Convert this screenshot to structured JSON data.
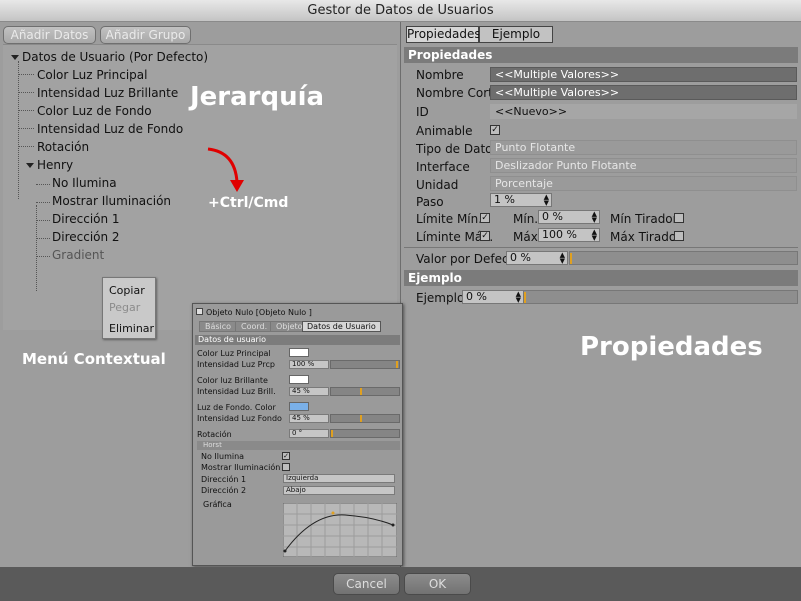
{
  "window": {
    "title": "Gestor de Datos de Usuarios"
  },
  "toolbar": {
    "add_data": "Añadir Datos",
    "add_group": "Añadir Grupo"
  },
  "tree": {
    "root": "Datos de Usuario (Por Defecto)",
    "items": [
      "Color Luz Principal",
      "Intensidad Luz Brillante",
      "Color Luz de Fondo",
      "Intensidad  Luz de Fondo",
      "Rotación"
    ],
    "group": "Henry",
    "group_items": [
      "No Ilumina",
      "Mostrar Iluminación",
      "Dirección 1",
      "Dirección 2",
      "Gradient"
    ]
  },
  "annotations": {
    "hierarchy": "Jerarquía",
    "ctrl": "+Ctrl/Cmd",
    "context_menu": "Menú Contextual",
    "properties": "Propiedades"
  },
  "context_menu": {
    "copy": "Copiar",
    "paste": "Pegar",
    "delete": "Eliminar"
  },
  "tabs": [
    "Propiedades",
    "Ejemplo"
  ],
  "props": {
    "section": "Propiedades",
    "name_label": "Nombre",
    "name_value": "<<Multiple Valores>>",
    "short_label": "Nombre Corto",
    "short_value": "<<Multiple Valores>>",
    "id_label": "ID",
    "id_value": "<<Nuevo>>",
    "animable_label": "Animable",
    "type_label": "Tipo de Dato",
    "type_value": "Punto Flotante",
    "iface_label": "Interface",
    "iface_value": "Deslizador Punto Flotante",
    "unit_label": "Unidad",
    "unit_value": "Porcentaje",
    "step_label": "Paso",
    "step_value": "1 %",
    "minlim_label": "Límite Mín.",
    "min_label": "Mín.",
    "min_value": "0 %",
    "mintir_label": "Mín Tirador",
    "maxlim_label": "Líminte Máx.",
    "max_label": "Máx",
    "max_value": "100 %",
    "maxtir_label": "Máx Tirador",
    "default_label": "Valor por Defecto",
    "default_value": "0 %",
    "default_fill": 0.0
  },
  "example": {
    "section": "Ejemplo",
    "label": "Ejemplo",
    "value": "0 %",
    "fill": 0.0
  },
  "footer": {
    "cancel": "Cancel",
    "ok": "OK"
  },
  "shot": {
    "title": "Objeto Nulo [Objeto Nulo ]",
    "tabs": [
      "Básico",
      "Coord.",
      "Objeto",
      "Datos de Usuario"
    ],
    "section": "Datos de usuario",
    "rows": [
      {
        "label": "Color Luz Principal"
      },
      {
        "label": "Intensidad Luz Prcp",
        "value": "100 %",
        "fill": 1.0
      },
      {
        "label": "Color luz Brillante"
      },
      {
        "label": "Intensidad Luz Brill.",
        "value": "45 %",
        "fill": 0.45
      },
      {
        "label": "Luz de Fondo. Color"
      },
      {
        "label": "Intensidad Luz Fondo",
        "value": "45 %",
        "fill": 0.45
      },
      {
        "label": "Rotación",
        "value": "0 °",
        "fill": 0.0
      }
    ],
    "group": "Horst",
    "no_ilumina": "No Ilumina",
    "mostrar": "Mostrar Iluminación",
    "dir1_label": "Dirección 1",
    "dir1_value": "Izquierda",
    "dir2_label": "Dirección 2",
    "dir2_value": "Abajo",
    "graph_label": "Gráfica"
  }
}
